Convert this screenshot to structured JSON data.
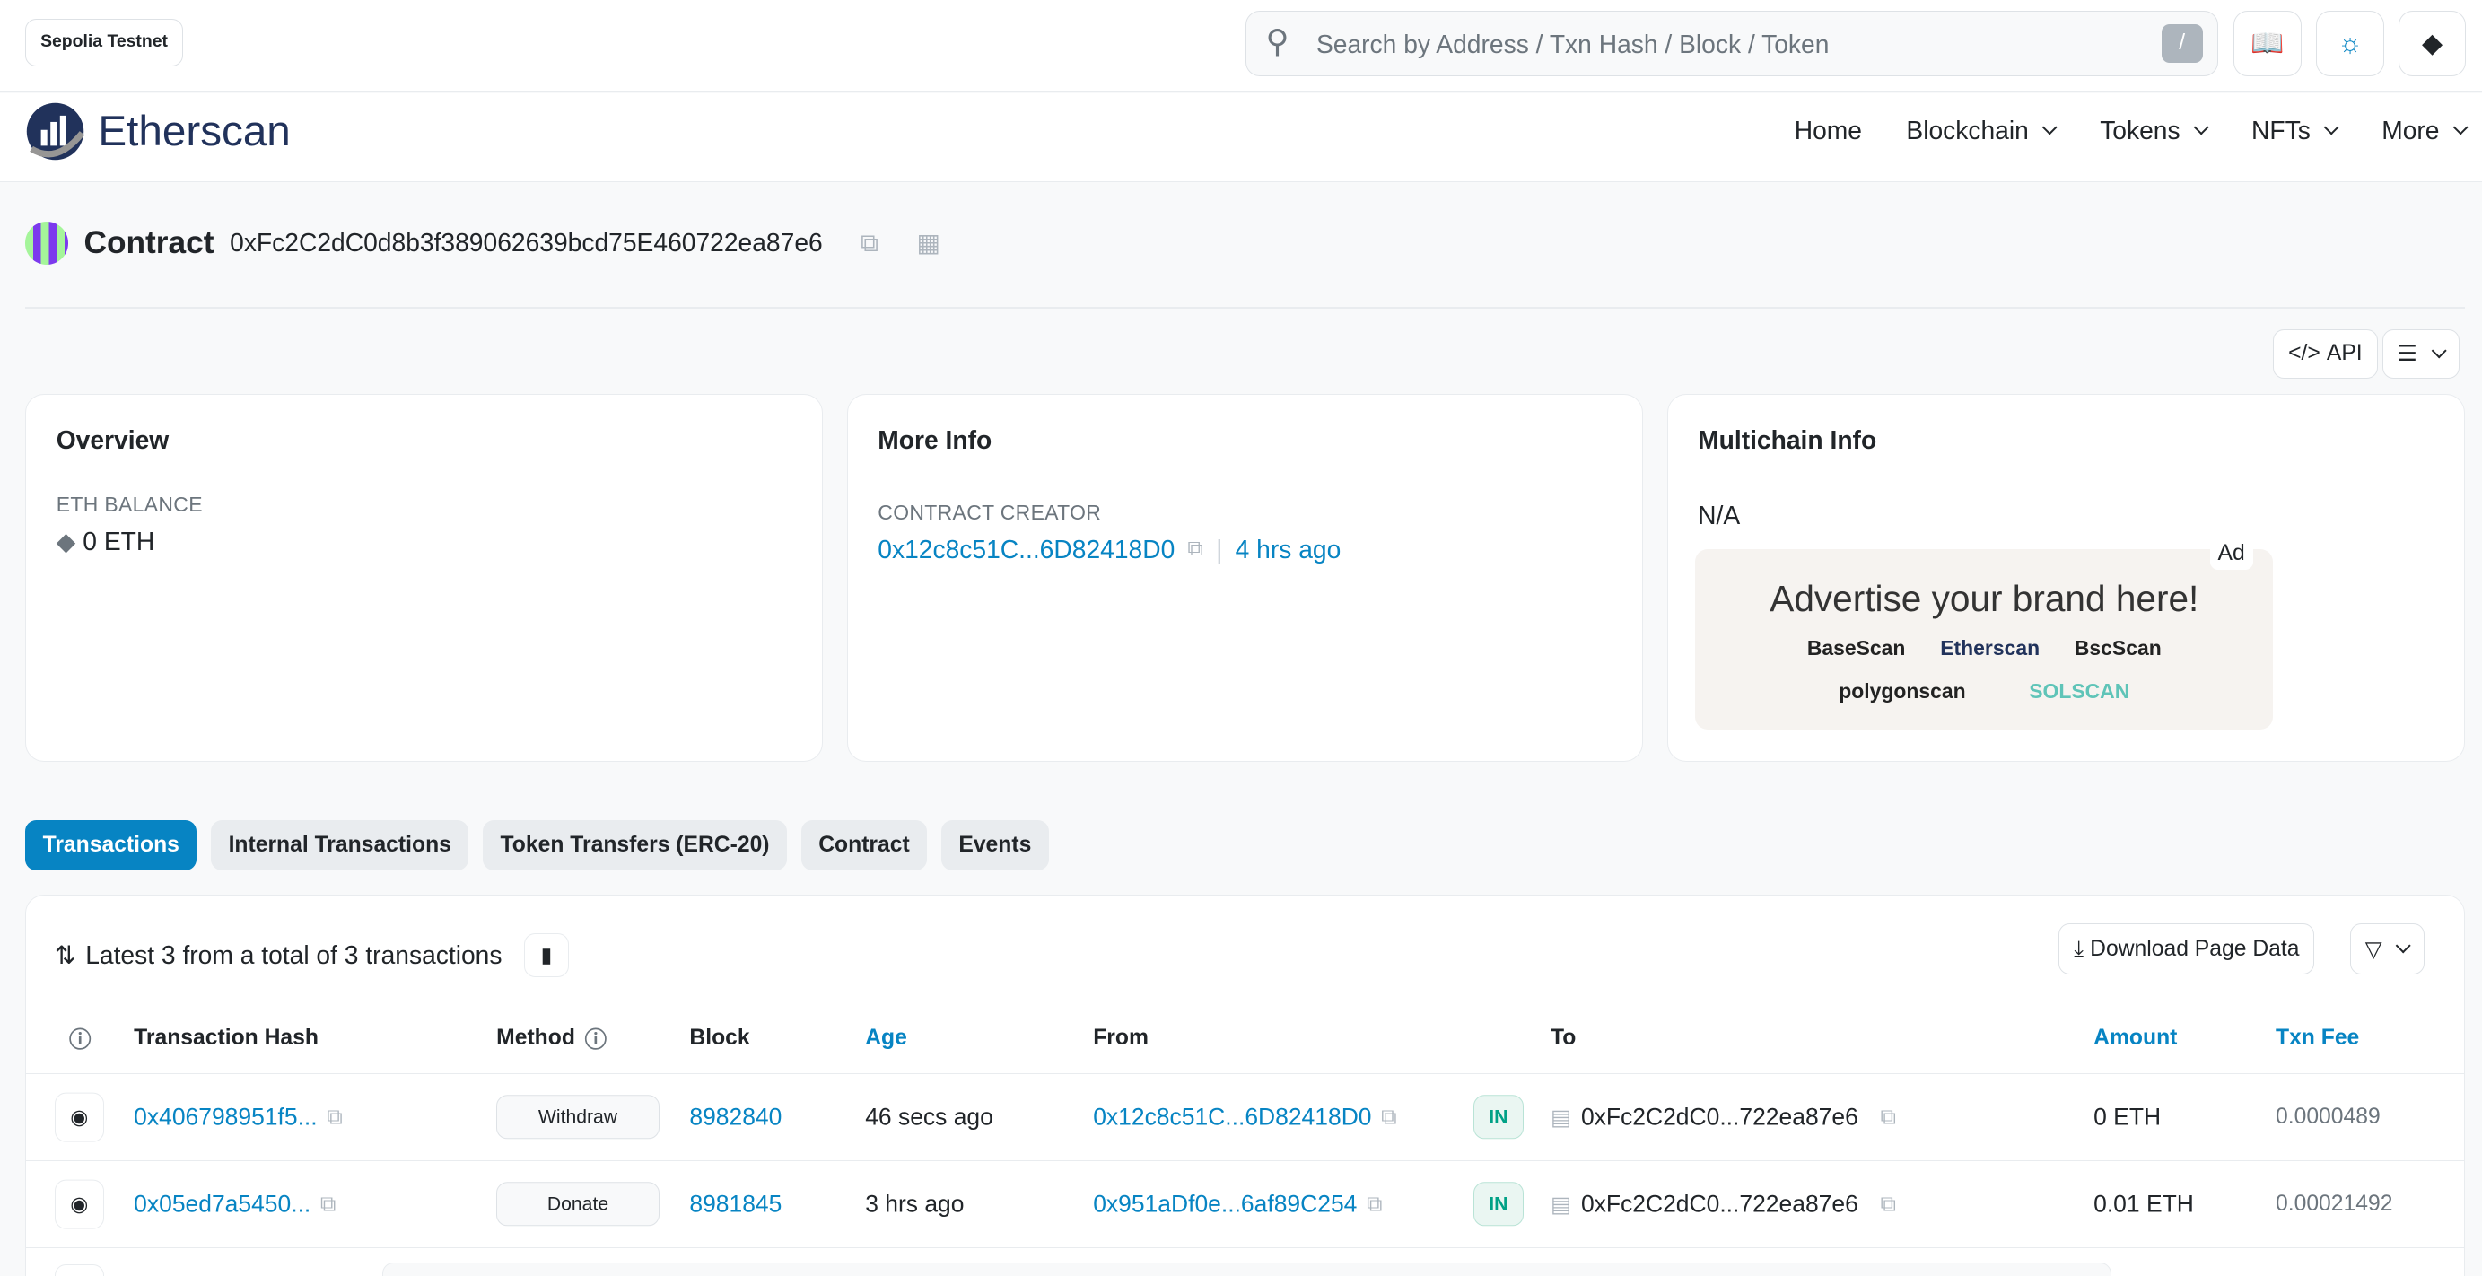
{
  "topbar": {
    "network": "Sepolia Testnet",
    "search_placeholder": "Search by Address / Txn Hash / Block / Token",
    "search_shortcut": "/"
  },
  "nav": {
    "brand": "Etherscan",
    "items": [
      "Home",
      "Blockchain",
      "Tokens",
      "NFTs",
      "More"
    ]
  },
  "contract": {
    "title": "Contract",
    "address": "0xFc2C2dC0d8b3f389062639bcd75E460722ea87e6"
  },
  "actions": {
    "api": "API"
  },
  "overview": {
    "title": "Overview",
    "balance_label": "ETH BALANCE",
    "balance": "0 ETH"
  },
  "more_info": {
    "title": "More Info",
    "creator_label": "CONTRACT CREATOR",
    "creator": "0x12c8c51C...6D82418D0",
    "separator": "|",
    "created": "4 hrs ago"
  },
  "multichain": {
    "title": "Multichain Info",
    "value": "N/A",
    "ad_tag": "Ad",
    "ad_headline": "Advertise your brand here!",
    "ad_brands": [
      "BaseScan",
      "Etherscan",
      "BscScan",
      "polygonscan",
      "SOLSCAN"
    ]
  },
  "tabs": [
    "Transactions",
    "Internal Transactions",
    "Token Transfers (ERC-20)",
    "Contract",
    "Events"
  ],
  "transactions": {
    "summary": "Latest 3 from a total of 3 transactions",
    "download": "Download Page Data",
    "columns": [
      "Transaction Hash",
      "Method",
      "Block",
      "Age",
      "From",
      "To",
      "Amount",
      "Txn Fee"
    ],
    "rows": [
      {
        "hash": "0x406798951f5...",
        "method": "Withdraw",
        "block": "8982840",
        "age": "46 secs ago",
        "from": "0x12c8c51C...6D82418D0",
        "direction": "IN",
        "to": "0xFc2C2dC0...722ea87e6",
        "amount": "0 ETH",
        "fee": "0.0000489"
      },
      {
        "hash": "0x05ed7a5450...",
        "method": "Donate",
        "block": "8981845",
        "age": "3 hrs ago",
        "from": "0x951aDf0e...6af89C254",
        "direction": "IN",
        "to": "0xFc2C2dC0...722ea87e6",
        "amount": "0.01 ETH",
        "fee": "0.00021492"
      }
    ]
  },
  "colors": {
    "link": "#0784c3",
    "brand": "#21325b",
    "active_tab": "#0784c3",
    "in_badge": "#00a186"
  }
}
